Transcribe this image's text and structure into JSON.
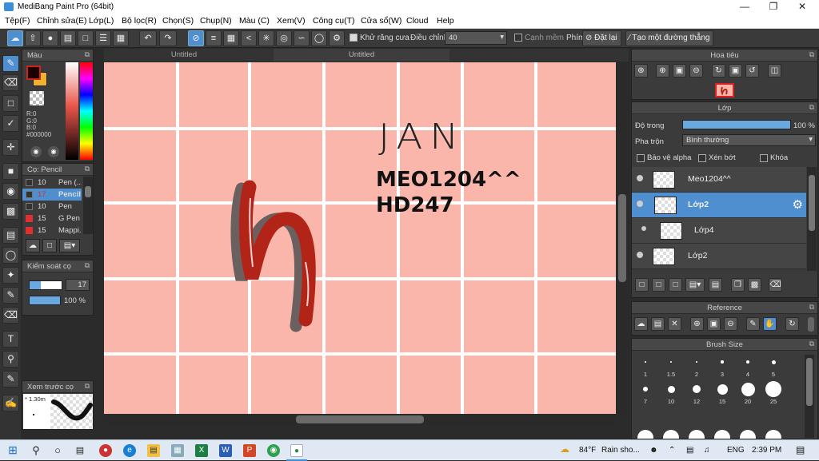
{
  "window": {
    "title": "MediBang Paint Pro (64bit)"
  },
  "menu": [
    "Tệp(F)",
    "Chỉnh sửa(E)",
    "Lớp(L)",
    "Bộ lọc(R)",
    "Chọn(S)",
    "Chụp(N)",
    "Màu (C)",
    "Xem(V)",
    "Công cụ(T)",
    "Cửa sổ(W)",
    "Cloud",
    "Help"
  ],
  "toolbar": {
    "antialias_label": "Khử răng cưa",
    "correction_label": "Điều chỉnh",
    "correction_value": "40",
    "edge_label": "Cạnh mềm",
    "shortcut_label": "Phím",
    "reset_label": "Đặt lại",
    "newline_label": "Tạo một đường thẳng"
  },
  "colors": {
    "primary": "#1a0000",
    "secondary": "#f0b030",
    "canvas_bg": "#fbb6ac",
    "accent": "#4f8fd0"
  },
  "color_panel": {
    "title": "Màu",
    "r": "R:0",
    "g": "G:0",
    "b": "B:0",
    "hex": "#000000"
  },
  "brush_panel": {
    "title": "Cọ: Pencil",
    "items": [
      {
        "size": "10",
        "name": "Pen (..."
      },
      {
        "size": "17",
        "name": "Pencil"
      },
      {
        "size": "10",
        "name": "Pen"
      },
      {
        "size": "15",
        "name": "G Pen"
      },
      {
        "size": "15",
        "name": "Mappi..."
      }
    ]
  },
  "brush_control": {
    "title": "Kiểm soát cọ",
    "size": "17",
    "opacity": "100 %"
  },
  "preview": {
    "title": "Xem trước cọ",
    "size": "1.30m"
  },
  "tabs": [
    "Untitled",
    "Untitled"
  ],
  "canvas_text": {
    "jan": "JAN",
    "line1": "MEO1204^^",
    "line2": "HD247"
  },
  "navigator": {
    "title": "Hoa tiêu"
  },
  "layer_panel": {
    "title": "Lớp",
    "opacity_label": "Độ trong",
    "opacity_value": "100 %",
    "opacity_fraction": 1.0,
    "blend_label": "Pha trộn",
    "blend_value": "Bình thường",
    "protect_alpha": "Bảo vệ alpha",
    "clip": "Xén bớt",
    "lock": "Khóa",
    "layers": [
      {
        "name": "Meo1204^^"
      },
      {
        "name": "Lớp2"
      },
      {
        "name": "Lớp4"
      },
      {
        "name": "Lớp2"
      }
    ]
  },
  "reference": {
    "title": "Reference"
  },
  "brush_size": {
    "title": "Brush Size",
    "sizes": [
      "1",
      "1.5",
      "2",
      "3",
      "4",
      "5",
      "7",
      "10",
      "12",
      "15",
      "20",
      "25"
    ]
  },
  "taskbar": {
    "weather_temp": "84°F",
    "weather_text": "Rain sho...",
    "lang": "ENG",
    "time": "2:39 PM"
  }
}
